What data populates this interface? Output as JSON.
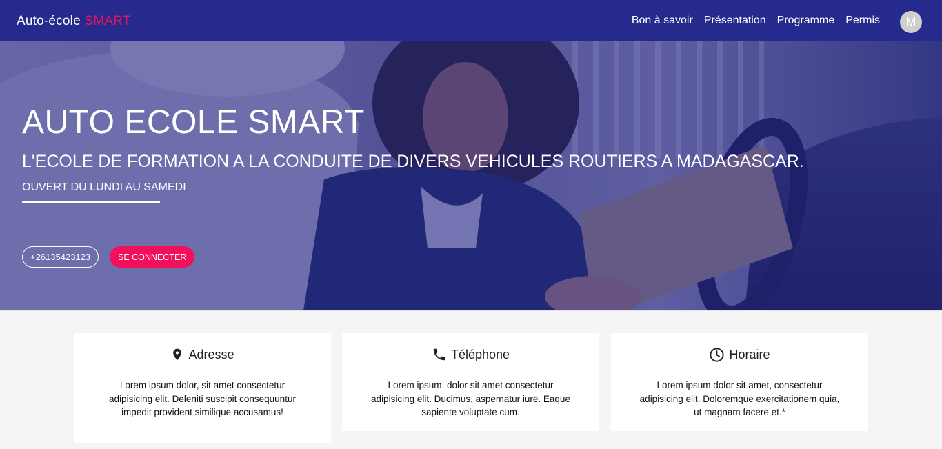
{
  "navbar": {
    "brand_main": "Auto-école",
    "brand_accent": "SMART",
    "links": [
      "Bon à savoir",
      "Présentation",
      "Programme",
      "Permis"
    ],
    "avatar_initial": "M"
  },
  "hero": {
    "title": "AUTO ECOLE SMART",
    "subtitle": "L'ECOLE DE FORMATION A LA CONDUITE DE DIVERS VEHICULES ROUTIERS A MADAGASCAR.",
    "hours": "OUVERT DU LUNDI AU SAMEDI",
    "phone_button": "+26135423123",
    "login_button": "SE CONNECTER"
  },
  "cards": [
    {
      "icon": "location-pin-icon",
      "title": "Adresse",
      "text": "Lorem ipsum dolor, sit amet consectetur adipisicing elit. Deleniti suscipit consequuntur impedit provident similique accusamus!"
    },
    {
      "icon": "phone-icon",
      "title": "Téléphone",
      "text": "Lorem ipsum, dolor sit amet consectetur adipisicing elit. Ducimus, aspernatur iure. Eaque sapiente voluptate cum."
    },
    {
      "icon": "clock-icon",
      "title": "Horaire",
      "text": "Lorem ipsum dolor sit amet, consectetur adipisicing elit. Doloremque exercitationem quia, ut magnam facere et.*"
    }
  ],
  "colors": {
    "navbar": "#262a8c",
    "accent": "#e8175d",
    "hero_overlay": "#23268c",
    "button_login": "#f0105c"
  }
}
